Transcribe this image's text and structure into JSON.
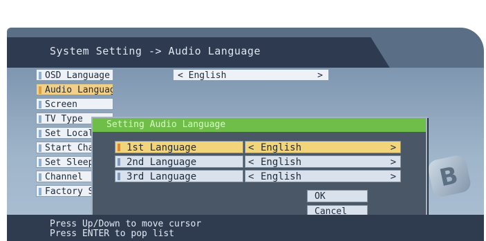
{
  "title": "System Setting -> Audio Language",
  "menu": {
    "items": [
      {
        "label": "OSD Language"
      },
      {
        "label": "Audio Language"
      },
      {
        "label": "Screen"
      },
      {
        "label": "TV Type"
      },
      {
        "label": "Set Local Time"
      },
      {
        "label": "Start Channel"
      },
      {
        "label": "Set Sleep Time"
      },
      {
        "label": "Channel"
      },
      {
        "label": "Factory Setting"
      }
    ],
    "osd_value": "English"
  },
  "dialog": {
    "title": "Setting Audio Language",
    "rows": [
      {
        "label": "1st Language",
        "value": "English"
      },
      {
        "label": "2nd Language",
        "value": "English"
      },
      {
        "label": "3rd Language",
        "value": "English"
      }
    ],
    "ok_label": "OK",
    "cancel_label": "Cancel"
  },
  "arrows": {
    "left": "<",
    "right": ">"
  },
  "logo_text": "B",
  "help": {
    "line1": "Press Up/Down to move cursor",
    "line2": "Press ENTER to pop list"
  },
  "colors": {
    "dialog_title": "#6fbe4a",
    "highlight": "#f2d47a",
    "bar": "#2d3a4f"
  }
}
